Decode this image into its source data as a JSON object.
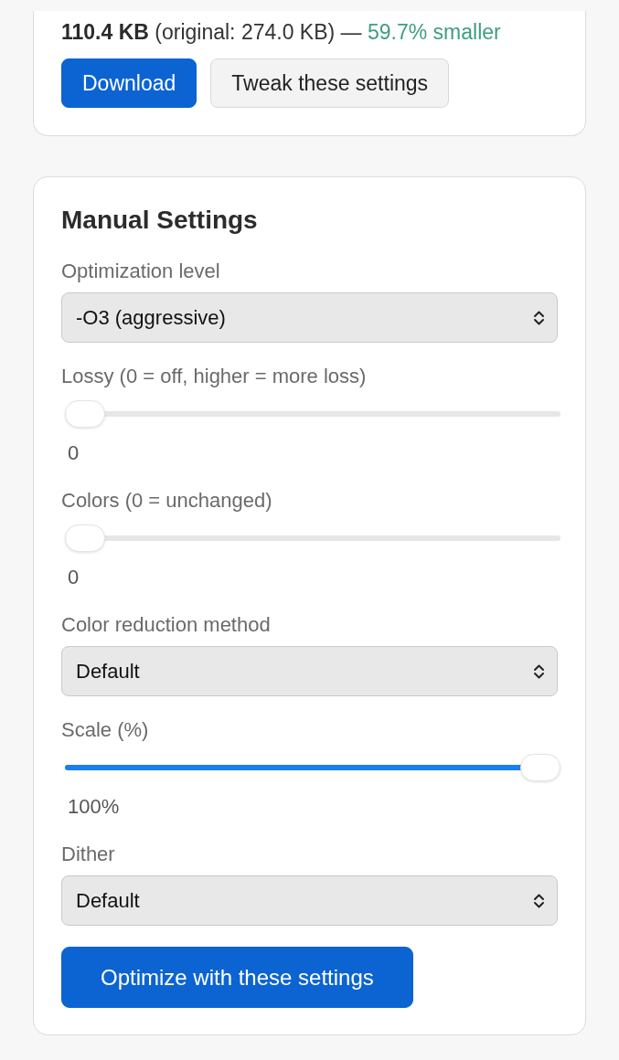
{
  "result": {
    "summary": "**110.4 KB** (original: 274.0 KB) —",
    "savings": "59.7% smaller",
    "buttons": [
      {
        "label": "Download",
        "kind": "primary"
      },
      {
        "label": "Tweak these settings",
        "kind": "secondary"
      }
    ]
  },
  "manual_settings": {
    "title": "Manual Settings",
    "fields": [
      {
        "kind": "select",
        "label": "Optimization level",
        "value": "-O3 (aggressive)"
      },
      {
        "kind": "slider",
        "label": "Lossy (0 = off, higher = more loss)",
        "level": 0,
        "reading": "0"
      },
      {
        "kind": "slider",
        "label": "Colors (0 = unchanged)",
        "level": 0,
        "reading": "0"
      },
      {
        "kind": "select",
        "label": "Color reduction method",
        "value": "Default"
      },
      {
        "kind": "slider",
        "label": "Scale (%)",
        "level": 1,
        "reading": "100%"
      },
      {
        "kind": "select",
        "label": "Dither",
        "value": "Default"
      }
    ],
    "button": "Optimize with these settings"
  }
}
